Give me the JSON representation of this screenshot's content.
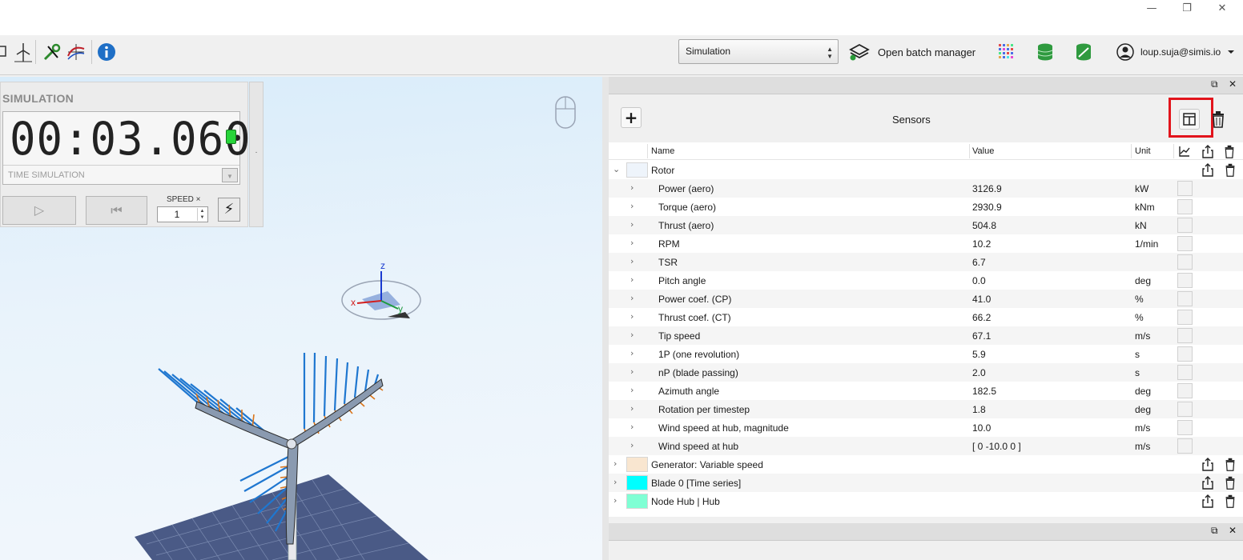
{
  "window": {
    "minimize_glyph": "—",
    "restore_glyph": "❐",
    "close_glyph": "✕"
  },
  "toolbar": {
    "mode_select": "Simulation",
    "batch_label": "Open batch manager",
    "user_email": "loup.suja@simis.io"
  },
  "simulation": {
    "title": "SIMULATION",
    "clock": "00:03.060",
    "time_label": "TIME SIMULATION",
    "speed_label": "SPEED ×",
    "speed_value": "1",
    "play_glyph": "▷",
    "rewind_glyph": "⏮",
    "bolt_glyph": "⚡",
    "handle_glyph": "·"
  },
  "axes": {
    "z": "z",
    "x": "x",
    "y": "y"
  },
  "sensors": {
    "title": "Sensors",
    "add_glyph": "+",
    "columns": {
      "name": "Name",
      "value": "Value",
      "unit": "Unit"
    },
    "groups": [
      {
        "name": "Rotor",
        "color": "#eef4fb"
      },
      {
        "name": "Generator: Variable speed",
        "color": "#f9e6d0"
      },
      {
        "name": "Blade 0 [Time series]",
        "color": "#00ffff"
      },
      {
        "name": "Node Hub | Hub",
        "color": "#7fffd4"
      }
    ],
    "rotor_rows": [
      {
        "name": "Power (aero)",
        "value": "3126.9",
        "unit": "kW"
      },
      {
        "name": "Torque (aero)",
        "value": "2930.9",
        "unit": "kNm"
      },
      {
        "name": "Thrust (aero)",
        "value": "504.8",
        "unit": "kN"
      },
      {
        "name": "RPM",
        "value": "10.2",
        "unit": "1/min"
      },
      {
        "name": "TSR",
        "value": "6.7",
        "unit": ""
      },
      {
        "name": "Pitch angle",
        "value": "0.0",
        "unit": "deg"
      },
      {
        "name": "Power coef. (CP)",
        "value": "41.0",
        "unit": "%"
      },
      {
        "name": "Thrust coef. (CT)",
        "value": "66.2",
        "unit": "%"
      },
      {
        "name": "Tip speed",
        "value": "67.1",
        "unit": "m/s"
      },
      {
        "name": "1P (one revolution)",
        "value": "5.9",
        "unit": "s"
      },
      {
        "name": "nP (blade passing)",
        "value": "2.0",
        "unit": "s"
      },
      {
        "name": "Azimuth angle",
        "value": "182.5",
        "unit": "deg"
      },
      {
        "name": "Rotation per timestep",
        "value": "1.8",
        "unit": "deg"
      },
      {
        "name": "Wind speed at hub, magnitude",
        "value": "10.0",
        "unit": "m/s"
      },
      {
        "name": "Wind speed at hub",
        "value": "[ 0 -10.0 0 ]",
        "unit": "m/s"
      }
    ]
  },
  "colors": {
    "highlight": "#e2141c",
    "led": "#27d43a",
    "ground": "#4a5a86",
    "normal_force": "#1f77d0",
    "tangential_force": "#d9741a"
  }
}
